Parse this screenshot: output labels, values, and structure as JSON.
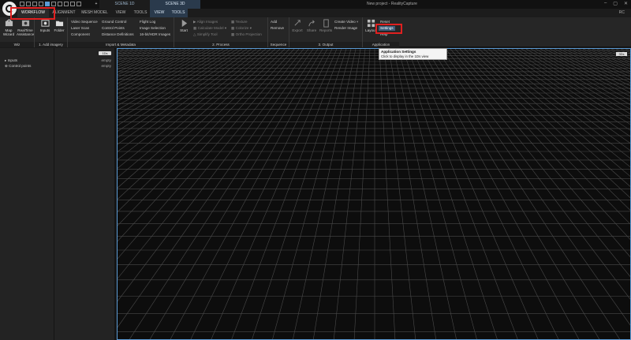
{
  "window": {
    "title": "New project - RealityCapture",
    "tabs": [
      "SCENE 1D",
      "SCENE 3D"
    ],
    "plus": "+",
    "status": "RC",
    "controls": [
      "–",
      "▢",
      "✕"
    ]
  },
  "ribbon_tabs": [
    "WORKFLOW",
    "ALIGNMENT",
    "MESH MODEL",
    "VIEW",
    "TOOLS",
    "VIEW",
    "TOOLS"
  ],
  "groups": {
    "wiz": {
      "label": "Wiz",
      "map_wizard": "Map Wizard",
      "realtime_assistance": "RealTime Assistance"
    },
    "imagery": {
      "label": "1. Add imagery",
      "inputs": "Inputs",
      "folder": "Folder"
    },
    "import_meta": {
      "label": "Import & Metadata",
      "col1": [
        "Video Sequence",
        "Laser Scan",
        "Component"
      ],
      "col2": [
        "Ground Control",
        "Control Points",
        "Distance Definitions"
      ],
      "col3": [
        "Flight Log",
        "Image Selection",
        "16-bit/HDR Images"
      ]
    },
    "process": {
      "label": "2. Process",
      "start": "Start",
      "col1": [
        "Align Images",
        "Calculate Model",
        "Simplify Tool"
      ],
      "col2": [
        "Texture",
        "Colorize",
        "Ortho Projection"
      ]
    },
    "sequence": {
      "label": "Sequence",
      "items": [
        "Add",
        "Remove"
      ]
    },
    "output": {
      "label": "3. Output",
      "export": "Export",
      "share": "Share",
      "reports": "Reports",
      "col": [
        "Create Video",
        "Render Image"
      ]
    },
    "application": {
      "label": "Application",
      "layout": "Layout",
      "items": [
        "Reset",
        "Settings",
        "Help"
      ]
    }
  },
  "tooltip": {
    "title": "Application Settings",
    "desc": "Click to display in the 1Ds view"
  },
  "left_panel": {
    "badge": "1Ds",
    "items": [
      {
        "label": "Inputs",
        "value": "empty"
      },
      {
        "label": "Control points",
        "value": "empty"
      }
    ]
  },
  "viewport": {
    "badge": "3Ds"
  },
  "colors": {
    "accent": "#5b9bd5",
    "highlight": "#e02020",
    "background": "#0d0d0d"
  }
}
